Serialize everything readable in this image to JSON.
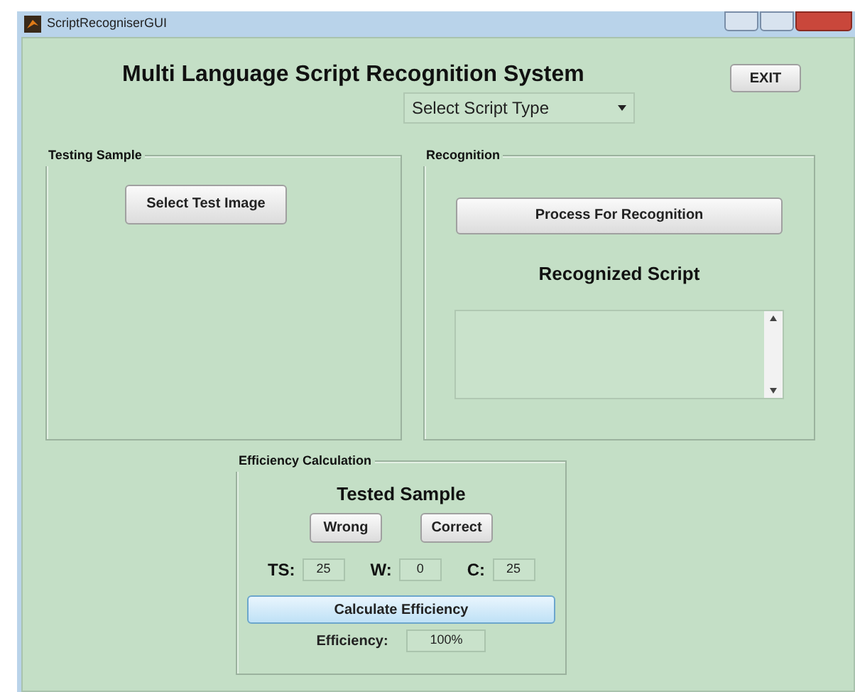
{
  "window": {
    "title": "ScriptRecogniserGUI"
  },
  "header": {
    "title": "Multi Language Script Recognition System",
    "exit_button": "EXIT",
    "script_type": {
      "value": "Select Script Type"
    }
  },
  "testing_sample": {
    "title": "Testing Sample",
    "button": "Select Test Image"
  },
  "recognition": {
    "title": "Recognition",
    "button": "Process For Recognition",
    "label": "Recognized Script"
  },
  "efficiency": {
    "title": "Efficiency Calculation",
    "subtitle": "Tested Sample",
    "buttons": [
      "Wrong",
      "Correct"
    ],
    "counts": [
      {
        "label": "TS:",
        "value": "25"
      },
      {
        "label": "W:",
        "value": "0"
      },
      {
        "label": "C:",
        "value": "25"
      }
    ],
    "calculate_button": "Calculate Efficiency",
    "result": {
      "label": "Efficiency:",
      "value": "100%"
    }
  }
}
